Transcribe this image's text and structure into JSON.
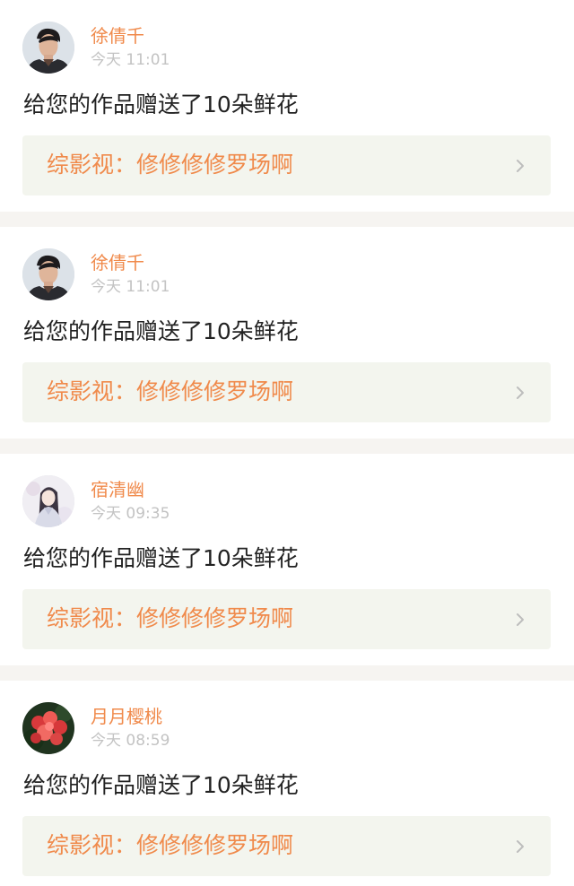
{
  "header": {
    "active_tab_indicator": "#e56aa4"
  },
  "notifications": [
    {
      "user_name": "徐倩千",
      "time": "今天 11:01",
      "message": "给您的作品赠送了10朵鲜花",
      "work_title": "综影视：修修修修罗场啊",
      "avatar_icon": "man-portrait-avatar"
    },
    {
      "user_name": "徐倩千",
      "time": "今天 11:01",
      "message": "给您的作品赠送了10朵鲜花",
      "work_title": "综影视：修修修修罗场啊",
      "avatar_icon": "man-portrait-avatar"
    },
    {
      "user_name": "宿清幽",
      "time": "今天 09:35",
      "message": "给您的作品赠送了10朵鲜花",
      "work_title": "综影视：修修修修罗场啊",
      "avatar_icon": "illustrated-girl-avatar"
    },
    {
      "user_name": "月月樱桃",
      "time": "今天 08:59",
      "message": "给您的作品赠送了10朵鲜花",
      "work_title": "综影视：修修修修罗场啊",
      "avatar_icon": "red-flower-avatar"
    }
  ],
  "colors": {
    "username": "#f08a4b",
    "timestamp": "#c3c3c3",
    "message": "#222222",
    "work_card_bg": "#f3f5ee",
    "separator": "#f6f4f1"
  }
}
